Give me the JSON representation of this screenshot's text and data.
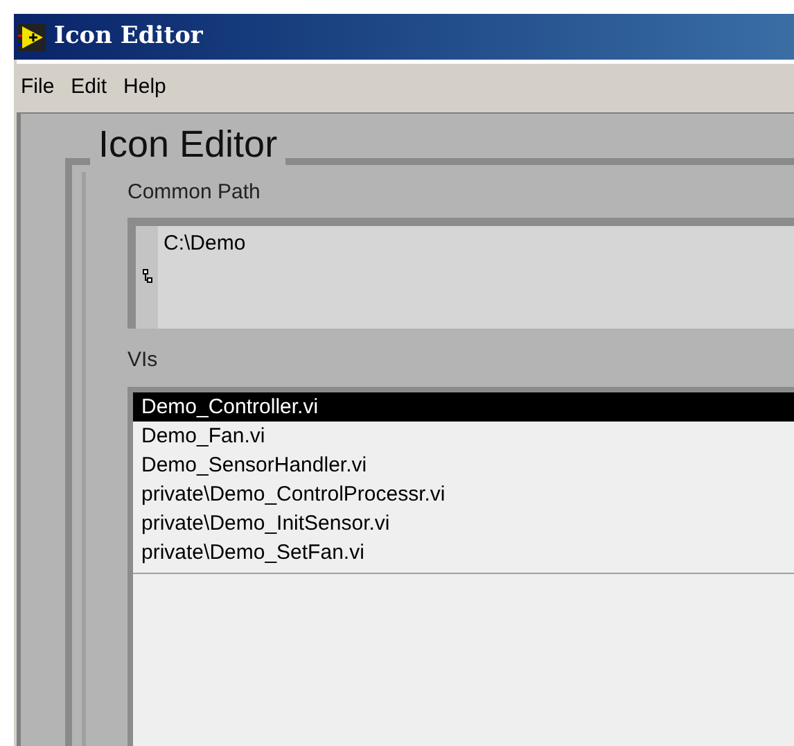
{
  "window": {
    "title": "Icon Editor"
  },
  "menu": [
    "File",
    "Edit",
    "Help"
  ],
  "group": {
    "title": "Icon Editor"
  },
  "common_path": {
    "label": "Common Path",
    "value": "C:\\Demo"
  },
  "vis": {
    "label": "VIs",
    "items": [
      {
        "text": "Demo_Controller.vi",
        "selected": true
      },
      {
        "text": "Demo_Fan.vi",
        "selected": false
      },
      {
        "text": "Demo_SensorHandler.vi",
        "selected": false
      },
      {
        "text": "private\\Demo_ControlProcessr.vi",
        "selected": false
      },
      {
        "text": "private\\Demo_InitSensor.vi",
        "selected": false
      },
      {
        "text": "private\\Demo_SetFan.vi",
        "selected": false
      }
    ]
  }
}
